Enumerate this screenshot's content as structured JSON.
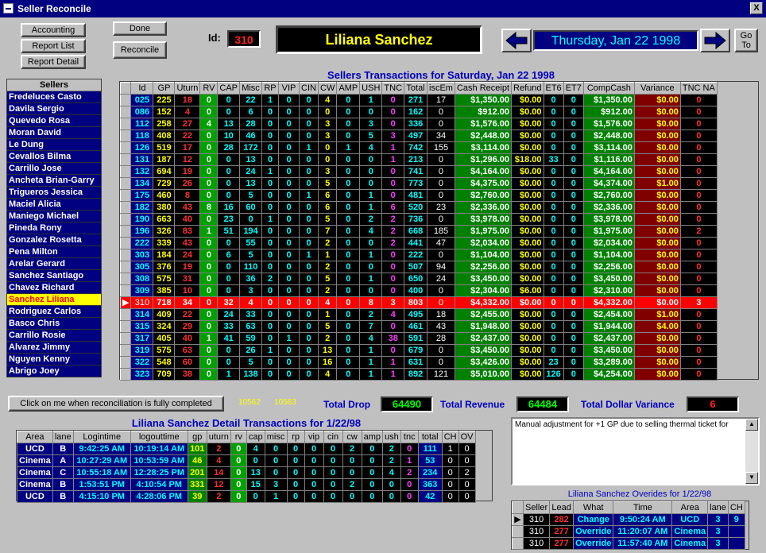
{
  "window": {
    "title": "Seller Reconcile",
    "close": "X"
  },
  "buttons": {
    "accounting": "Accounting",
    "report_list": "Report List",
    "report_detail": "Report Detail",
    "done": "Done",
    "reconcile": "Reconcile",
    "goto": "Go To",
    "confirm": "Click on me  when reconciliation is fully completed"
  },
  "id_label": "Id:",
  "id_value": "310",
  "seller_name": "Liliana  Sanchez",
  "date_display": "Thursday, Jan 22 1998",
  "sellers": {
    "header": "Sellers",
    "items": [
      "Fredeluces Casto",
      "Davila Sergio",
      "Quevedo Rosa",
      "Moran David",
      "Le Dung",
      "Cevallos Bilma",
      "Carrillo Jose",
      "Ancheta Brian-Garry",
      "Trigueros Jessica",
      "Maciel Alicia",
      "Maniego Michael",
      "Pineda Rony",
      "Gonzalez Rosetta",
      "Pena Milton",
      "Arelar Gerard",
      "Sanchez Santiago",
      "Chavez Richard",
      "Sanchez Liliana",
      "Rodriguez Carlos",
      "Basco Chris",
      "Carrillo Rosie",
      "Alvarez Jimmy",
      "Nguyen Kenny",
      "Abrigo Joey"
    ],
    "selected": "Sanchez Liliana"
  },
  "main_table": {
    "caption": "Sellers Transactions for Saturday, Jan 22 1998",
    "columns": [
      "Id",
      "GP",
      "Uturn",
      "RV",
      "CAP",
      "Misc",
      "RP",
      "VIP",
      "CIN",
      "CW",
      "AMP",
      "USH",
      "TNC",
      "Total",
      "iscEm",
      "Cash Receipt",
      "Refund",
      "ET6",
      "ET7",
      "CompCash",
      "Variance",
      "TNC NA"
    ],
    "rows": [
      [
        "025",
        "225",
        "18",
        "0",
        "0",
        "22",
        "1",
        "0",
        "0",
        "4",
        "0",
        "1",
        "0",
        "271",
        "17",
        "$1,350.00",
        "$0.00",
        "0",
        "0",
        "$1,350.00",
        "$0.00",
        "0"
      ],
      [
        "086",
        "152",
        "4",
        "0",
        "0",
        "6",
        "0",
        "0",
        "0",
        "0",
        "0",
        "0",
        "0",
        "162",
        "0",
        "$912.00",
        "$0.00",
        "0",
        "0",
        "$912.00",
        "$0.00",
        "0"
      ],
      [
        "112",
        "258",
        "27",
        "4",
        "13",
        "28",
        "0",
        "0",
        "0",
        "3",
        "0",
        "3",
        "0",
        "336",
        "0",
        "$1,576.00",
        "$0.00",
        "0",
        "0",
        "$1,576.00",
        "$0.00",
        "0"
      ],
      [
        "118",
        "408",
        "22",
        "0",
        "10",
        "46",
        "0",
        "0",
        "0",
        "3",
        "0",
        "5",
        "3",
        "497",
        "34",
        "$2,448.00",
        "$0.00",
        "0",
        "0",
        "$2,448.00",
        "$0.00",
        "0"
      ],
      [
        "126",
        "519",
        "17",
        "0",
        "28",
        "172",
        "0",
        "0",
        "1",
        "0",
        "1",
        "4",
        "1",
        "742",
        "155",
        "$3,114.00",
        "$0.00",
        "0",
        "0",
        "$3,114.00",
        "$0.00",
        "0"
      ],
      [
        "131",
        "187",
        "12",
        "0",
        "0",
        "13",
        "0",
        "0",
        "0",
        "0",
        "0",
        "0",
        "1",
        "213",
        "0",
        "$1,296.00",
        "$18.00",
        "33",
        "0",
        "$1,116.00",
        "$0.00",
        "0"
      ],
      [
        "132",
        "694",
        "19",
        "0",
        "0",
        "24",
        "1",
        "0",
        "0",
        "3",
        "0",
        "0",
        "0",
        "741",
        "0",
        "$4,164.00",
        "$0.00",
        "0",
        "0",
        "$4,164.00",
        "$0.00",
        "0"
      ],
      [
        "134",
        "729",
        "26",
        "0",
        "0",
        "13",
        "0",
        "0",
        "0",
        "5",
        "0",
        "0",
        "0",
        "773",
        "0",
        "$4,375.00",
        "$0.00",
        "0",
        "0",
        "$4,374.00",
        "$1.00",
        "0"
      ],
      [
        "175",
        "460",
        "8",
        "0",
        "0",
        "5",
        "0",
        "0",
        "1",
        "6",
        "0",
        "1",
        "0",
        "481",
        "0",
        "$2,760.00",
        "$0.00",
        "0",
        "0",
        "$2,760.00",
        "$0.00",
        "0"
      ],
      [
        "182",
        "380",
        "43",
        "8",
        "16",
        "60",
        "0",
        "0",
        "0",
        "6",
        "0",
        "1",
        "6",
        "520",
        "23",
        "$2,336.00",
        "$0.00",
        "0",
        "0",
        "$2,336.00",
        "$0.00",
        "0"
      ],
      [
        "190",
        "663",
        "40",
        "0",
        "23",
        "0",
        "1",
        "0",
        "0",
        "5",
        "0",
        "2",
        "2",
        "736",
        "0",
        "$3,978.00",
        "$0.00",
        "0",
        "0",
        "$3,978.00",
        "$0.00",
        "0"
      ],
      [
        "196",
        "326",
        "83",
        "1",
        "51",
        "194",
        "0",
        "0",
        "0",
        "7",
        "0",
        "4",
        "2",
        "668",
        "185",
        "$1,975.00",
        "$0.00",
        "0",
        "0",
        "$1,975.00",
        "$0.00",
        "2"
      ],
      [
        "222",
        "339",
        "43",
        "0",
        "0",
        "55",
        "0",
        "0",
        "0",
        "2",
        "0",
        "0",
        "2",
        "441",
        "47",
        "$2,034.00",
        "$0.00",
        "0",
        "0",
        "$2,034.00",
        "$0.00",
        "0"
      ],
      [
        "303",
        "184",
        "24",
        "0",
        "6",
        "5",
        "0",
        "0",
        "1",
        "1",
        "0",
        "1",
        "0",
        "222",
        "0",
        "$1,104.00",
        "$0.00",
        "0",
        "0",
        "$1,104.00",
        "$0.00",
        "0"
      ],
      [
        "305",
        "376",
        "19",
        "0",
        "0",
        "110",
        "0",
        "0",
        "0",
        "2",
        "0",
        "0",
        "0",
        "507",
        "94",
        "$2,256.00",
        "$0.00",
        "0",
        "0",
        "$2,256.00",
        "$0.00",
        "0"
      ],
      [
        "308",
        "575",
        "31",
        "0",
        "0",
        "36",
        "2",
        "0",
        "0",
        "5",
        "0",
        "1",
        "0",
        "650",
        "24",
        "$3,450.00",
        "$0.00",
        "0",
        "0",
        "$3,450.00",
        "$0.00",
        "0"
      ],
      [
        "309",
        "385",
        "10",
        "0",
        "0",
        "3",
        "0",
        "0",
        "0",
        "2",
        "0",
        "0",
        "0",
        "400",
        "0",
        "$2,304.00",
        "$6.00",
        "0",
        "0",
        "$2,310.00",
        "$0.00",
        "0"
      ],
      [
        "310",
        "718",
        "34",
        "0",
        "32",
        "4",
        "0",
        "0",
        "0",
        "4",
        "0",
        "8",
        "3",
        "803",
        "0",
        "$4,332.00",
        "$0.00",
        "0",
        "0",
        "$4,332.00",
        "$0.00",
        "3"
      ],
      [
        "314",
        "409",
        "22",
        "0",
        "24",
        "33",
        "0",
        "0",
        "0",
        "1",
        "0",
        "2",
        "4",
        "495",
        "18",
        "$2,455.00",
        "$0.00",
        "0",
        "0",
        "$2,454.00",
        "$1.00",
        "0"
      ],
      [
        "315",
        "324",
        "29",
        "0",
        "33",
        "63",
        "0",
        "0",
        "0",
        "5",
        "0",
        "7",
        "0",
        "461",
        "43",
        "$1,948.00",
        "$0.00",
        "0",
        "0",
        "$1,944.00",
        "$4.00",
        "0"
      ],
      [
        "317",
        "405",
        "40",
        "1",
        "41",
        "59",
        "0",
        "1",
        "0",
        "2",
        "0",
        "4",
        "38",
        "591",
        "28",
        "$2,437.00",
        "$0.00",
        "0",
        "0",
        "$2,437.00",
        "$0.00",
        "0"
      ],
      [
        "319",
        "575",
        "63",
        "0",
        "0",
        "26",
        "1",
        "0",
        "0",
        "13",
        "0",
        "1",
        "0",
        "679",
        "0",
        "$3,450.00",
        "$0.00",
        "0",
        "0",
        "$3,450.00",
        "$0.00",
        "0"
      ],
      [
        "322",
        "548",
        "60",
        "0",
        "0",
        "5",
        "0",
        "0",
        "0",
        "16",
        "0",
        "1",
        "1",
        "631",
        "0",
        "$3,426.00",
        "$0.00",
        "23",
        "0",
        "$3,289.00",
        "$0.00",
        "0"
      ],
      [
        "323",
        "709",
        "38",
        "0",
        "1",
        "138",
        "0",
        "0",
        "0",
        "4",
        "0",
        "1",
        "1",
        "892",
        "121",
        "$5,010.00",
        "$0.00",
        "126",
        "0",
        "$4,254.00",
        "$0.00",
        "0"
      ]
    ],
    "selected_id": "310"
  },
  "codes": {
    "a": "10562",
    "b": "10563"
  },
  "totals": {
    "drop_label": "Total Drop",
    "drop_value": "64490",
    "revenue_label": "Total Revenue",
    "revenue_value": "64484",
    "variance_label": "Total Dollar Variance",
    "variance_value": "6"
  },
  "detail": {
    "caption": "Liliana Sanchez Detail Transactions for 1/22/98",
    "columns": [
      "Area",
      "lane",
      "Logintime",
      "logouttime",
      "gp",
      "uturn",
      "rv",
      "cap",
      "misc",
      "rp",
      "vip",
      "cin",
      "cw",
      "amp",
      "ush",
      "tnc",
      "total",
      "CH",
      "OV"
    ],
    "rows": [
      [
        "UCD",
        "B",
        "9:42:25 AM",
        "10:19:14 AM",
        "101",
        "2",
        "0",
        "4",
        "0",
        "0",
        "0",
        "0",
        "2",
        "0",
        "2",
        "0",
        "111",
        "1",
        "0"
      ],
      [
        "Cinema",
        "A",
        "10:27:29 AM",
        "10:53:59 AM",
        "46",
        "4",
        "0",
        "0",
        "0",
        "0",
        "0",
        "0",
        "0",
        "0",
        "2",
        "1",
        "53",
        "0",
        "0"
      ],
      [
        "Cinema",
        "C",
        "10:55:18 AM",
        "12:28:25 PM",
        "201",
        "14",
        "0",
        "13",
        "0",
        "0",
        "0",
        "0",
        "0",
        "0",
        "4",
        "2",
        "234",
        "0",
        "2"
      ],
      [
        "Cinema",
        "B",
        "1:53:51 PM",
        "4:10:54 PM",
        "331",
        "12",
        "0",
        "15",
        "3",
        "0",
        "0",
        "0",
        "2",
        "0",
        "0",
        "0",
        "363",
        "0",
        "0"
      ],
      [
        "UCD",
        "B",
        "4:15:10 PM",
        "4:28:06 PM",
        "39",
        "2",
        "0",
        "0",
        "1",
        "0",
        "0",
        "0",
        "0",
        "0",
        "0",
        "0",
        "42",
        "0",
        "0"
      ]
    ]
  },
  "notes": "Manual adjustment for +1 GP due to selling thermal ticket for",
  "overrides": {
    "caption": "Liliana Sanchez Overides for 1/22/98",
    "columns": [
      "Seller",
      "Lead",
      "What",
      "Time",
      "Area",
      "lane",
      "CH"
    ],
    "rows": [
      [
        "310",
        "282",
        "Change",
        "9:50:24 AM",
        "UCD",
        "3",
        "9"
      ],
      [
        "310",
        "277",
        "Override",
        "11:20:07 AM",
        "Cinema",
        "3",
        ""
      ],
      [
        "310",
        "277",
        "Override",
        "11:57:40 AM",
        "Cinema",
        "3",
        ""
      ]
    ]
  },
  "colors": {
    "title": "#000080",
    "accent_green": "#00a000",
    "highlight": "#ff0000"
  }
}
